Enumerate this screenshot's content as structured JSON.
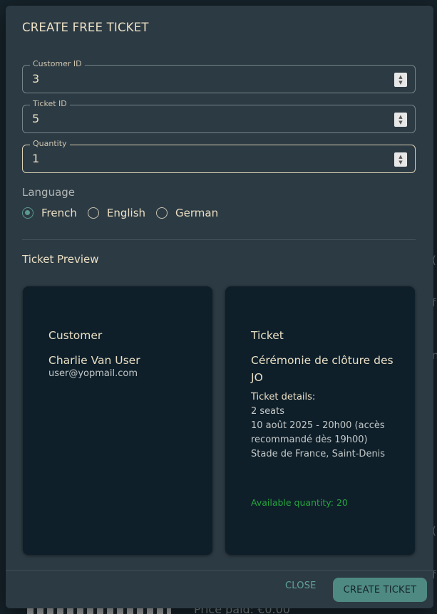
{
  "modal": {
    "title": "CREATE FREE TICKET"
  },
  "fields": {
    "customer_id": {
      "label": "Customer ID",
      "value": "3"
    },
    "ticket_id": {
      "label": "Ticket ID",
      "value": "5"
    },
    "quantity": {
      "label": "Quantity",
      "value": "1"
    }
  },
  "language": {
    "label": "Language",
    "options": [
      "French",
      "English",
      "German"
    ],
    "selected": "French"
  },
  "preview": {
    "title": "Ticket Preview",
    "customer": {
      "heading": "Customer",
      "name": "Charlie Van User",
      "email": "user@yopmail.com"
    },
    "ticket": {
      "heading": "Ticket",
      "name": "Cérémonie de clôture des JO",
      "details_heading": "Ticket details:",
      "seats": "2 seats",
      "date": "10 août 2025 - 20h00 (accès recommandé dès 19h00)",
      "venue": "Stade de France, Saint-Denis",
      "availability": "Available quantity: 20"
    }
  },
  "actions": {
    "close": "CLOSE",
    "create": "CREATE TICKET"
  },
  "background": {
    "bottom_text": "Price paid: €0.00"
  },
  "colors": {
    "accent": "#4f8a82",
    "available": "#27a33f",
    "text": "#eadfc4",
    "modal_bg": "#2c3a43",
    "card_bg": "#0e1f2a"
  }
}
